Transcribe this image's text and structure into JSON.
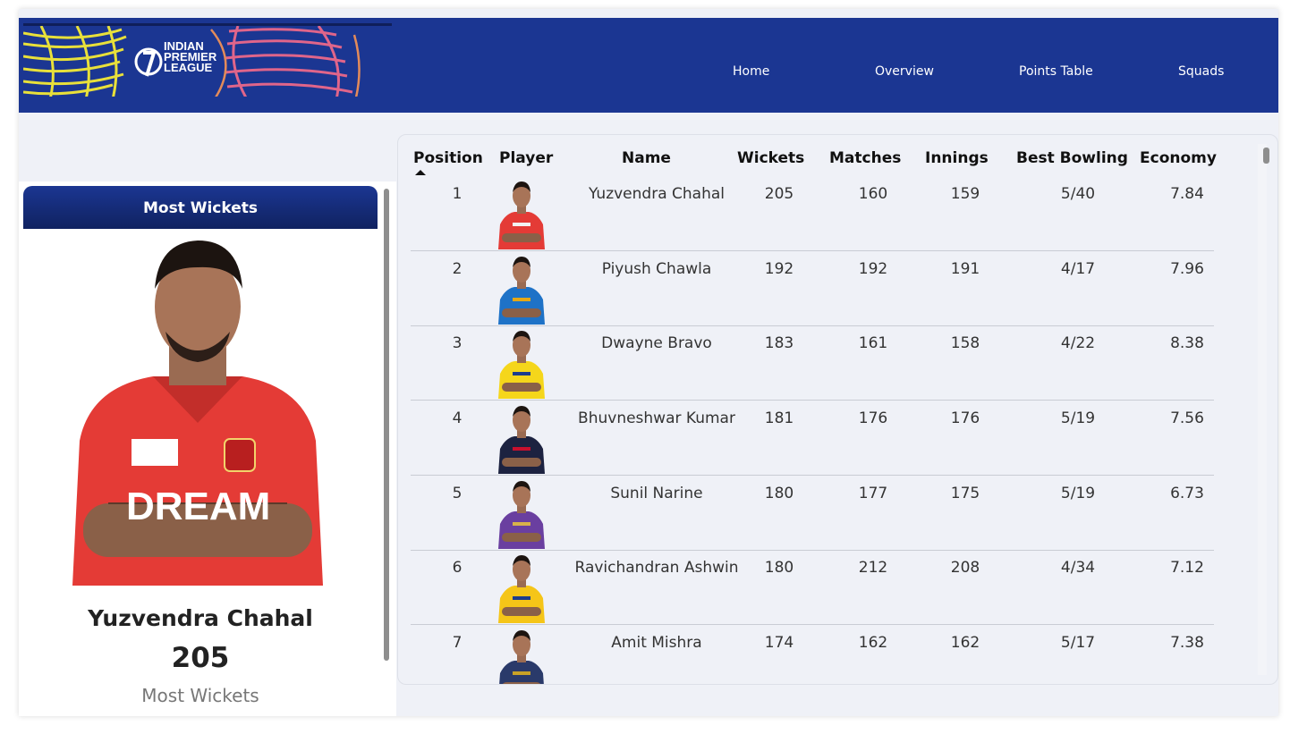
{
  "nav": {
    "logo_text": [
      "INDIAN",
      "PREMIER",
      "LEAGUE"
    ],
    "links": [
      "Home",
      "Overview",
      "Points Table",
      "Squads"
    ]
  },
  "featured": {
    "header": "Most Wickets",
    "name": "Yuzvendra Chahal",
    "value": "205",
    "label": "Most Wickets"
  },
  "table": {
    "columns": [
      "Position",
      "Player",
      "Name",
      "Wickets",
      "Matches",
      "Innings",
      "Best Bowling",
      "Economy"
    ],
    "rows": [
      {
        "position": "1",
        "name": "Yuzvendra Chahal",
        "wickets": "205",
        "matches": "160",
        "innings": "159",
        "best": "5/40",
        "economy": "7.84",
        "jersey": "#e43b36",
        "accent": "#f2f2f2"
      },
      {
        "position": "2",
        "name": "Piyush Chawla",
        "wickets": "192",
        "matches": "192",
        "innings": "191",
        "best": "4/17",
        "economy": "7.96",
        "jersey": "#1e72c7",
        "accent": "#e6a817"
      },
      {
        "position": "3",
        "name": "Dwayne Bravo",
        "wickets": "183",
        "matches": "161",
        "innings": "158",
        "best": "4/22",
        "economy": "8.38",
        "jersey": "#f5d61b",
        "accent": "#1c3c8c"
      },
      {
        "position": "4",
        "name": "Bhuvneshwar Kumar",
        "wickets": "181",
        "matches": "176",
        "innings": "176",
        "best": "5/19",
        "economy": "7.56",
        "jersey": "#1c2240",
        "accent": "#c8102e"
      },
      {
        "position": "5",
        "name": "Sunil Narine",
        "wickets": "180",
        "matches": "177",
        "innings": "175",
        "best": "5/19",
        "economy": "6.73",
        "jersey": "#6a3fa0",
        "accent": "#d8b24a"
      },
      {
        "position": "6",
        "name": "Ravichandran Ashwin",
        "wickets": "180",
        "matches": "212",
        "innings": "208",
        "best": "4/34",
        "economy": "7.12",
        "jersey": "#f5c518",
        "accent": "#1c3c8c"
      },
      {
        "position": "7",
        "name": "Amit Mishra",
        "wickets": "174",
        "matches": "162",
        "innings": "162",
        "best": "5/17",
        "economy": "7.38",
        "jersey": "#2a3a6a",
        "accent": "#c9a227"
      }
    ]
  }
}
